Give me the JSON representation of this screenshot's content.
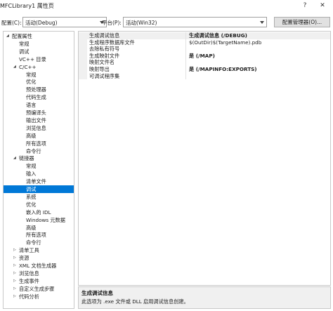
{
  "window": {
    "title": "MFCLibrary1 属性页",
    "help_glyph": "?",
    "close_glyph": "✕"
  },
  "toolbar": {
    "config_label": "配置(C):",
    "config_value": "活动(Debug)",
    "platform_label": "平台(P):",
    "platform_value": "活动(Win32)",
    "config_manager_label": "配置管理器(O)..."
  },
  "tree": {
    "items": [
      {
        "label": "配置属性",
        "level": 0,
        "arrow": "open",
        "selected": false
      },
      {
        "label": "常规",
        "level": 1,
        "arrow": "",
        "selected": false
      },
      {
        "label": "调试",
        "level": 1,
        "arrow": "",
        "selected": false
      },
      {
        "label": "VC++ 目录",
        "level": 1,
        "arrow": "",
        "selected": false
      },
      {
        "label": "C/C++",
        "level": 1,
        "arrow": "open",
        "selected": false
      },
      {
        "label": "常规",
        "level": 2,
        "arrow": "",
        "selected": false
      },
      {
        "label": "优化",
        "level": 2,
        "arrow": "",
        "selected": false
      },
      {
        "label": "预处理器",
        "level": 2,
        "arrow": "",
        "selected": false
      },
      {
        "label": "代码生成",
        "level": 2,
        "arrow": "",
        "selected": false
      },
      {
        "label": "语言",
        "level": 2,
        "arrow": "",
        "selected": false
      },
      {
        "label": "预编译头",
        "level": 2,
        "arrow": "",
        "selected": false
      },
      {
        "label": "输出文件",
        "level": 2,
        "arrow": "",
        "selected": false
      },
      {
        "label": "浏览信息",
        "level": 2,
        "arrow": "",
        "selected": false
      },
      {
        "label": "高级",
        "level": 2,
        "arrow": "",
        "selected": false
      },
      {
        "label": "所有选项",
        "level": 2,
        "arrow": "",
        "selected": false
      },
      {
        "label": "命令行",
        "level": 2,
        "arrow": "",
        "selected": false
      },
      {
        "label": "链接器",
        "level": 1,
        "arrow": "open",
        "selected": false
      },
      {
        "label": "常规",
        "level": 2,
        "arrow": "",
        "selected": false
      },
      {
        "label": "输入",
        "level": 2,
        "arrow": "",
        "selected": false
      },
      {
        "label": "清单文件",
        "level": 2,
        "arrow": "",
        "selected": false
      },
      {
        "label": "调试",
        "level": 2,
        "arrow": "",
        "selected": true
      },
      {
        "label": "系统",
        "level": 2,
        "arrow": "",
        "selected": false
      },
      {
        "label": "优化",
        "level": 2,
        "arrow": "",
        "selected": false
      },
      {
        "label": "嵌入的 IDL",
        "level": 2,
        "arrow": "",
        "selected": false
      },
      {
        "label": "Windows 元数据",
        "level": 2,
        "arrow": "",
        "selected": false
      },
      {
        "label": "高级",
        "level": 2,
        "arrow": "",
        "selected": false
      },
      {
        "label": "所有选项",
        "level": 2,
        "arrow": "",
        "selected": false
      },
      {
        "label": "命令行",
        "level": 2,
        "arrow": "",
        "selected": false
      },
      {
        "label": "清单工具",
        "level": 1,
        "arrow": "closed",
        "selected": false
      },
      {
        "label": "资源",
        "level": 1,
        "arrow": "closed",
        "selected": false
      },
      {
        "label": "XML 文档生成器",
        "level": 1,
        "arrow": "closed",
        "selected": false
      },
      {
        "label": "浏览信息",
        "level": 1,
        "arrow": "closed",
        "selected": false
      },
      {
        "label": "生成事件",
        "level": 1,
        "arrow": "closed",
        "selected": false
      },
      {
        "label": "自定义生成步骤",
        "level": 1,
        "arrow": "closed",
        "selected": false
      },
      {
        "label": "代码分析",
        "level": 1,
        "arrow": "closed",
        "selected": false
      }
    ]
  },
  "grid": {
    "rows": [
      {
        "name": "生成调试信息",
        "value": "生成调试信息 (/DEBUG)",
        "bold": true
      },
      {
        "name": "生成程序数据库文件",
        "value": "$(OutDir)$(TargetName).pdb",
        "bold": false
      },
      {
        "name": "去除私有符号",
        "value": "",
        "bold": false
      },
      {
        "name": "生成映射文件",
        "value": "是 (/MAP)",
        "bold": true
      },
      {
        "name": "映射文件名",
        "value": "",
        "bold": false
      },
      {
        "name": "映射导出",
        "value": "是 (/MAPINFO:EXPORTS)",
        "bold": true
      },
      {
        "name": "可调试程序集",
        "value": "",
        "bold": false
      }
    ]
  },
  "description": {
    "title": "生成调试信息",
    "text": "此选项为 .exe 文件或 DLL 启用调试信息创建。"
  }
}
